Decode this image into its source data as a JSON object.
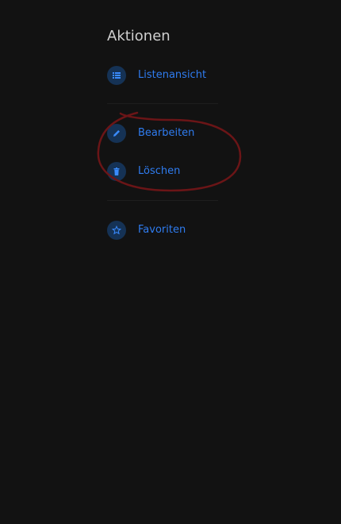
{
  "panel": {
    "title": "Aktionen",
    "items": [
      {
        "label": "Listenansicht",
        "icon": "list-icon"
      },
      {
        "label": "Bearbeiten",
        "icon": "pencil-icon"
      },
      {
        "label": "Löschen",
        "icon": "trash-icon"
      },
      {
        "label": "Favoriten",
        "icon": "star-icon"
      }
    ]
  },
  "colors": {
    "background": "#121212",
    "title": "#cfcfcf",
    "link": "#2f7cf0",
    "icon_circle": "#153255",
    "divider": "#1e1e1e",
    "annotation": "#6b1517"
  }
}
